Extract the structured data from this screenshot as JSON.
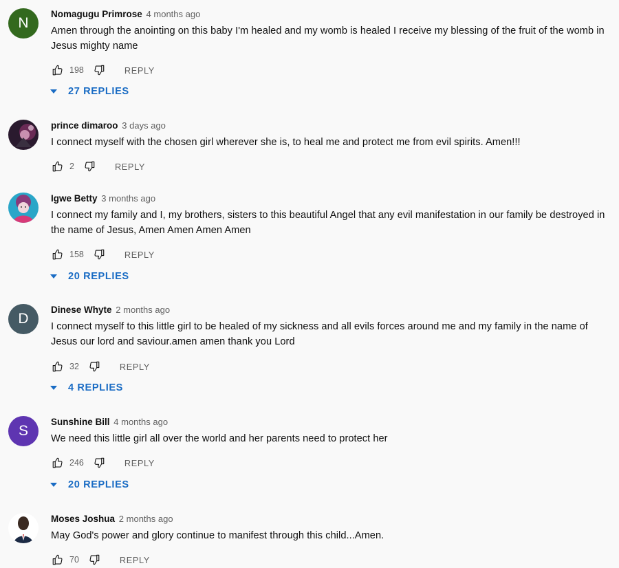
{
  "comments": [
    {
      "author": "Nomagugu Primrose",
      "time": "4 months ago",
      "text": "Amen through the anointing on this baby I'm healed and my womb is healed I receive my blessing of the fruit of the womb in Jesus mighty name",
      "likes": "198",
      "reply_label": "REPLY",
      "replies": "27 REPLIES",
      "avatar_letter": "N",
      "avatar_color": "#33691e"
    },
    {
      "author": "prince dimaroo",
      "time": "3 days ago",
      "text": "I connect myself with the chosen girl wherever she is, to heal me and protect me from evil spirits. Amen!!!",
      "likes": "2",
      "reply_label": "REPLY",
      "avatar_icon": "photo-avatar"
    },
    {
      "author": "Igwe Betty",
      "time": "3 months ago",
      "text": "I connect my family and I, my brothers, sisters to this beautiful Angel that any evil manifestation in our family be destroyed in the name of Jesus, Amen Amen Amen Amen",
      "likes": "158",
      "reply_label": "REPLY",
      "replies": "20 REPLIES",
      "avatar_icon": "photo-avatar"
    },
    {
      "author": "Dinese Whyte",
      "time": "2 months ago",
      "text": "I connect myself to this little girl to be healed of my sickness and all evils forces around me and my family in the name of Jesus our lord and saviour.amen amen thank you Lord",
      "likes": "32",
      "reply_label": "REPLY",
      "replies": "4 REPLIES",
      "avatar_letter": "D",
      "avatar_color": "#455a64"
    },
    {
      "author": "Sunshine Bill",
      "time": "4 months ago",
      "text": "We need this little girl all over the world and her parents need to protect her",
      "likes": "246",
      "reply_label": "REPLY",
      "replies": "20 REPLIES",
      "avatar_letter": "S",
      "avatar_color": "#5e35b1"
    },
    {
      "author": "Moses Joshua",
      "time": "2 months ago",
      "text": "May God's power and glory continue to manifest through this child...Amen.",
      "likes": "70",
      "reply_label": "REPLY",
      "avatar_icon": "photo-avatar"
    }
  ],
  "icons": {
    "like": "thumb-up-icon",
    "dislike": "thumb-down-icon",
    "expand": "caret-down-icon"
  },
  "colors": {
    "link_blue": "#1a6cc4",
    "secondary_text": "#606060",
    "background": "#f9f9f9"
  }
}
